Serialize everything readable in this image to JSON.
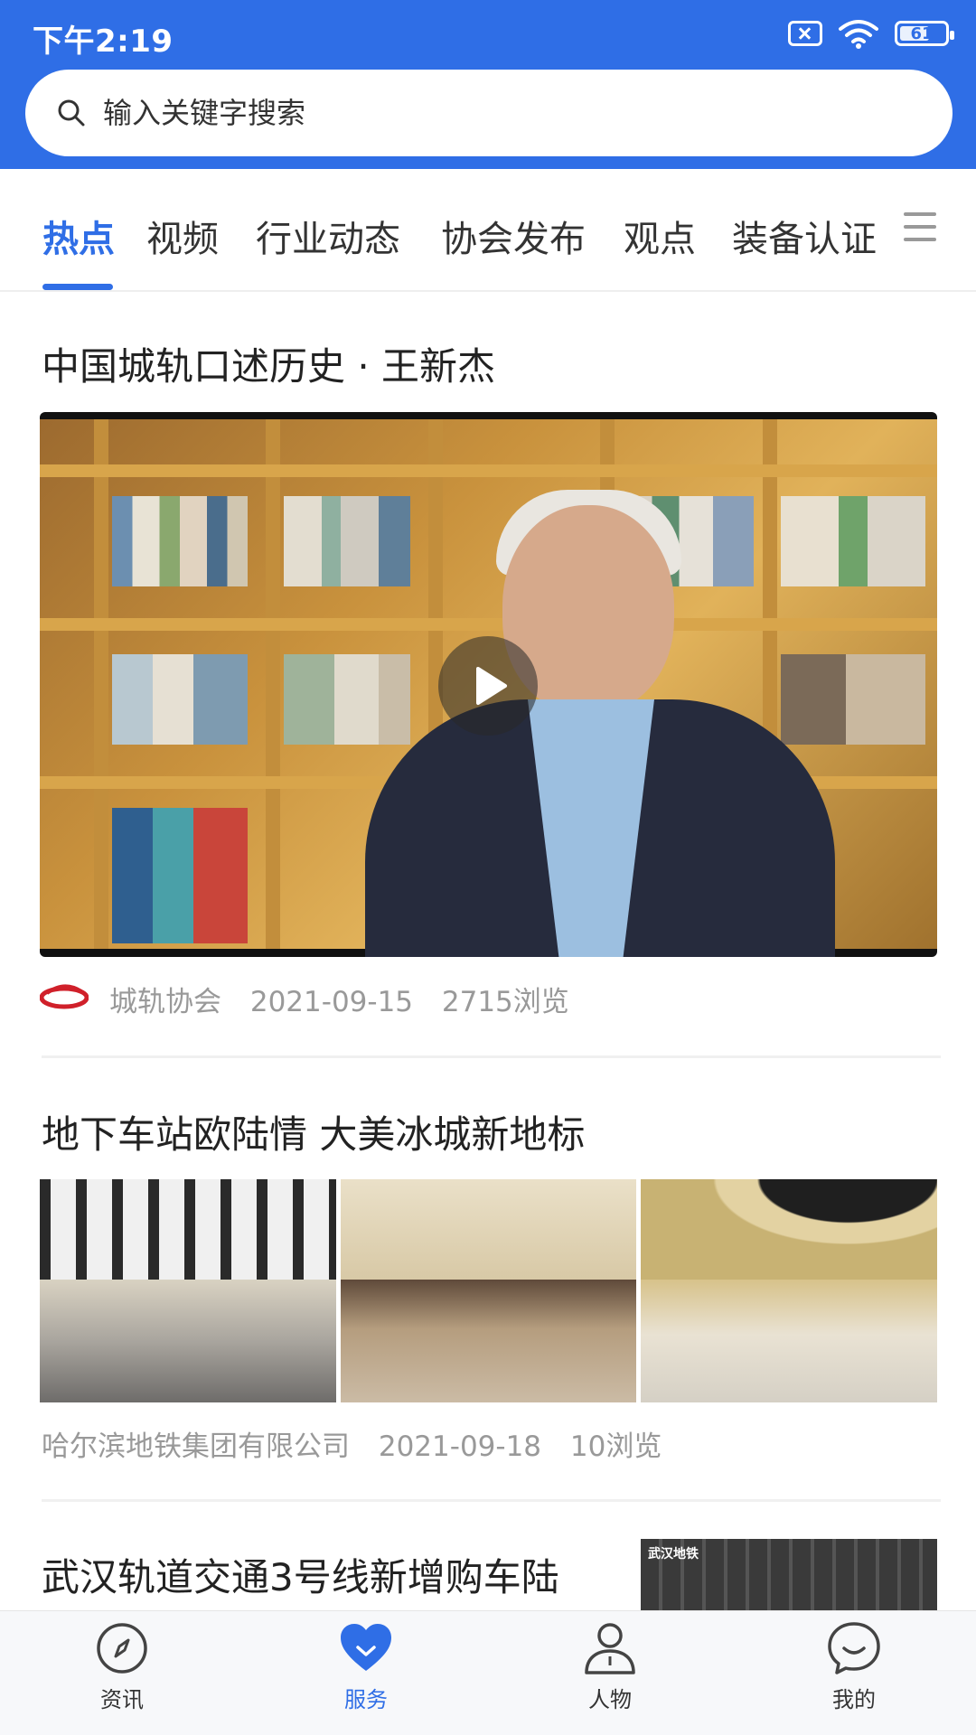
{
  "status_bar": {
    "time": "下午2:19",
    "battery": "61"
  },
  "search": {
    "placeholder": "输入关键字搜索"
  },
  "tabs": [
    {
      "label": "热点",
      "active": true
    },
    {
      "label": "视频"
    },
    {
      "label": "行业动态"
    },
    {
      "label": "协会发布"
    },
    {
      "label": "观点"
    },
    {
      "label": "装备认证"
    }
  ],
  "articles": [
    {
      "title": "中国城轨口述历史 · 王新杰",
      "source": "城轨协会",
      "date": "2021-09-15",
      "views": "2715浏览"
    },
    {
      "title": "地下车站欧陆情 大美冰城新地标",
      "source": "哈尔滨地铁集团有限公司",
      "date": "2021-09-18",
      "views": "10浏览"
    },
    {
      "title": "武汉轨道交通3号线新增购车陆",
      "thumb_label": "武汉地铁"
    }
  ],
  "bottom_nav": [
    {
      "label": "资讯",
      "icon": "compass-icon"
    },
    {
      "label": "服务",
      "icon": "heart-icon",
      "active": true
    },
    {
      "label": "人物",
      "icon": "person-icon"
    },
    {
      "label": "我的",
      "icon": "smile-chat-icon"
    }
  ],
  "colors": {
    "accent": "#2f6ee6",
    "muted": "#999999"
  }
}
